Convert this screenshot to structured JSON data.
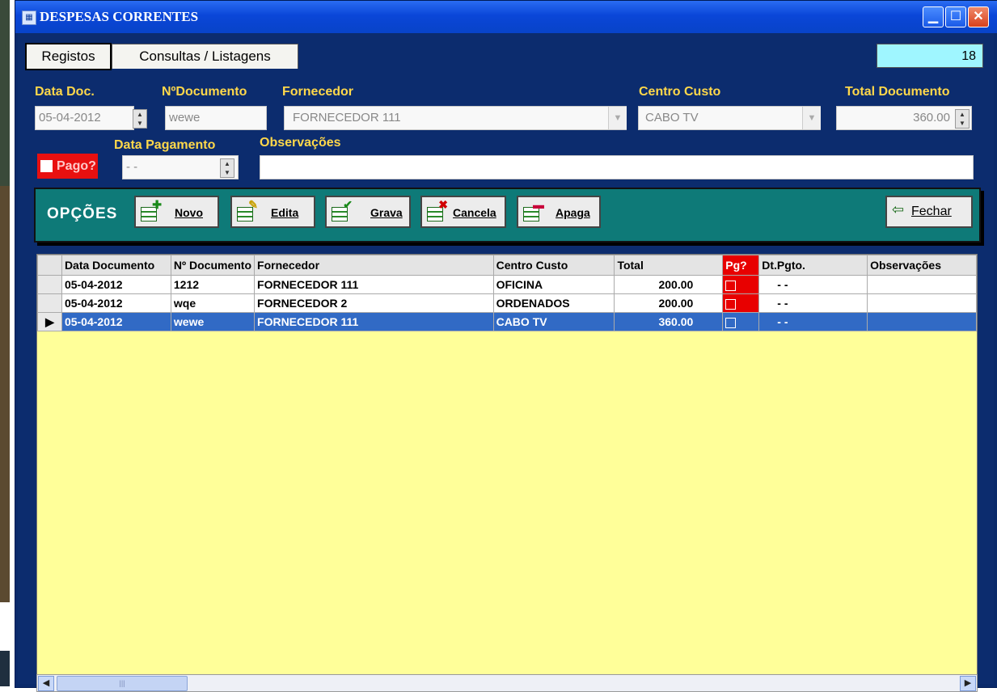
{
  "window": {
    "title": "DESPESAS CORRENTES"
  },
  "tabs": [
    "Registos",
    "Consultas / Listagens"
  ],
  "record_counter": "18",
  "form": {
    "data_doc_label": "Data Doc.",
    "data_doc_value": "05-04-2012",
    "n_documento_label": "NºDocumento",
    "n_documento_value": "wewe",
    "fornecedor_label": "Fornecedor",
    "fornecedor_value": "FORNECEDOR 111",
    "centro_custo_label": "Centro Custo",
    "centro_custo_value": "CABO TV",
    "total_label": "Total Documento",
    "total_value": "360.00",
    "pago_label": "Pago?",
    "data_pagamento_label": "Data Pagamento",
    "data_pagamento_value": "  -  -",
    "observacoes_label": "Observações",
    "observacoes_value": ""
  },
  "options": {
    "label": "OPÇÕES",
    "novo": "Novo",
    "edita": "Edita",
    "grava": "Grava",
    "cancela": "Cancela",
    "apaga": "Apaga",
    "fechar": "Fechar"
  },
  "grid": {
    "columns": [
      "Data Documento",
      "Nº Documento",
      "Fornecedor",
      "Centro Custo",
      "Total",
      "Pg?",
      "Dt.Pgto.",
      "Observações"
    ],
    "rows": [
      {
        "data": "05-04-2012",
        "num": "1212",
        "fornecedor": "FORNECEDOR 111",
        "centro": "OFICINA",
        "total": "200.00",
        "dtpgto": "-  -",
        "obs": ""
      },
      {
        "data": "05-04-2012",
        "num": "wqe",
        "fornecedor": "FORNECEDOR 2",
        "centro": "ORDENADOS",
        "total": "200.00",
        "dtpgto": "-  -",
        "obs": ""
      },
      {
        "data": "05-04-2012",
        "num": "wewe",
        "fornecedor": "FORNECEDOR 111",
        "centro": "CABO TV",
        "total": "360.00",
        "dtpgto": "-  -",
        "obs": ""
      }
    ]
  },
  "colors": {
    "window_bg": "#0c2c6e",
    "label": "#ffd84a",
    "grid_bg": "#ffff99",
    "selection": "#316ac5",
    "options_bg": "#0e7a78",
    "pago_red": "#e81010"
  }
}
